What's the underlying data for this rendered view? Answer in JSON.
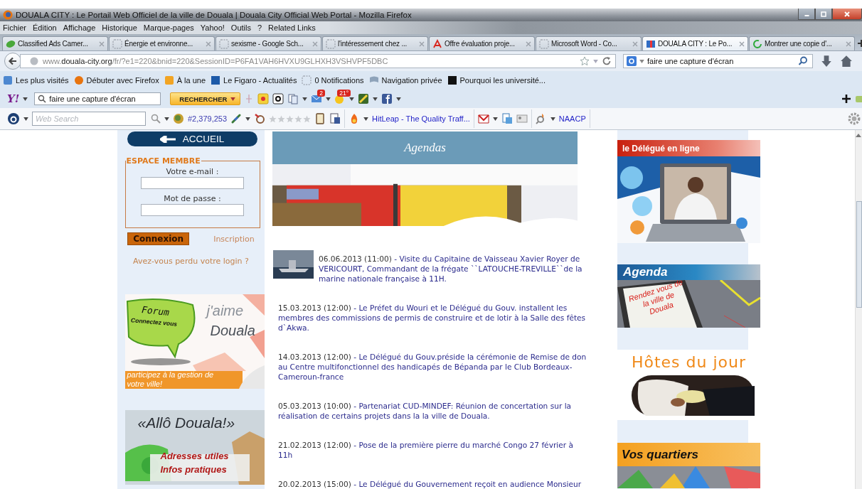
{
  "window": {
    "title": "DOUALA CITY : Le Portail Web Officiel de la ville de Douala | Douala City Official Web Portal - Mozilla Firefox"
  },
  "menu": [
    "Fichier",
    "Édition",
    "Affichage",
    "Historique",
    "Marque-pages",
    "Yahoo!",
    "Outils",
    "?",
    "Related Links"
  ],
  "tabs": [
    {
      "label": "Classified Ads Camer...",
      "kind": "leaf",
      "selected": false
    },
    {
      "label": "Énergie et environne...",
      "kind": "blank",
      "selected": false
    },
    {
      "label": "sexisme - Google Sch...",
      "kind": "blank",
      "selected": false
    },
    {
      "label": "l'intéressement chez ...",
      "kind": "blank",
      "selected": false
    },
    {
      "label": "Offre évaluation proje...",
      "kind": "pdf",
      "selected": false
    },
    {
      "label": "Microsoft Word - Co...",
      "kind": "blank",
      "selected": false
    },
    {
      "label": "DOUALA CITY : Le Po...",
      "kind": "site",
      "selected": true
    },
    {
      "label": "Montrer une copie d'...",
      "kind": "loading",
      "selected": false
    }
  ],
  "address_bar": {
    "url": "www.**douala-city.org**/fr/?e1=220&bnid=220&SessionID=P6FA1VAH6HVXU9GLHXH3VSHVPF5DBC"
  },
  "search_bar": {
    "value": "faire une capture d'écran"
  },
  "bookmarks": [
    {
      "label": "Les plus visités",
      "kind": "book"
    },
    {
      "label": "Débuter avec Firefox",
      "kind": "firefox"
    },
    {
      "label": "À la une",
      "kind": "rss"
    },
    {
      "label": "Le Figaro - Actualités",
      "kind": "figaro"
    },
    {
      "label": "0 Notifications",
      "kind": "blank"
    },
    {
      "label": "Navigation privée",
      "kind": "flag"
    },
    {
      "label": "Pourquoi les université...",
      "kind": "dark"
    }
  ],
  "yahoo_toolbar": {
    "logo": "Y!",
    "search_value": "faire une capture d'écran",
    "button": "RECHERCHER",
    "mail_badge": "2",
    "weather_badge": "21°"
  },
  "addon_toolbar": {
    "search_placeholder": "Web Search",
    "rank": "#2,379,253",
    "stars": 0,
    "links": [
      "HitLeap - The Quality Traff...",
      "NAACP"
    ]
  },
  "left_panel": {
    "home_button": "ACCUEIL",
    "login": {
      "legend": "ESPACE MEMBRE",
      "email_label": "Votre e-mail :",
      "password_label": "Mot de passe :",
      "submit": "Connexion",
      "register": "Inscription",
      "forgot": "Avez-vous perdu votre login ?"
    },
    "forum_banner": {
      "bubble_title": "Forum",
      "bubble_text": "Connectez vous",
      "slogan_1": "j'aime",
      "slogan_2": "Douala",
      "caption": "participez à la gestion de votre ville!"
    },
    "allo_banner": {
      "title": "«Allô Douala!»",
      "lines": [
        "Adresses utiles",
        "Infos pratiques"
      ]
    }
  },
  "agenda": {
    "title": "Agendas",
    "items": [
      {
        "date": "06.06.2013 (11:00)",
        "text": "- Visite du Capitaine de Vaisseau Xavier Royer de VERICOURT, Commandant de la frégate ``LATOUCHE-TREVILLE``de la marine nationale française à 11H.",
        "has_thumbnail": true
      },
      {
        "date": "15.03.2013 (12:00)",
        "text": "- Le Préfet du Wouri et le Délégué du Gouv. installent les membres des commissions de permis de construire et de lotir à la Salle des fêtes d`Akwa.",
        "has_thumbnail": false
      },
      {
        "date": "14.03.2013 (12:00)",
        "text": "- Le Délégué du Gouv.préside la cérémonie de Remise de don au Centre multifonctionnel des handicapés de Bépanda par le Club Bordeaux-Cameroun-france",
        "has_thumbnail": false
      },
      {
        "date": "05.03.2013 (10:00)",
        "text": "- Partenariat CUD-MINDEF: Réunion de concertation sur la réalisation de certains projets dans la la ville de Douala.",
        "has_thumbnail": false
      },
      {
        "date": "21.02.2013 (12:00)",
        "text": "- Pose de la première pierre du marché Congo 27 février à 11h",
        "has_thumbnail": false
      },
      {
        "date": "20.02.2013 (15:00)",
        "text": "- Le Délégué du Gouvernement reçoit en audience Monsieur",
        "has_thumbnail": false
      }
    ]
  },
  "right_panel": {
    "delegate_banner": "le Délégué en ligne",
    "agenda_banner": {
      "title": "Agenda",
      "note": "Rendez vous de la ville de Douala"
    },
    "guests_title": "Hôtes du jour",
    "districts_banner": "Vos quartiers"
  }
}
